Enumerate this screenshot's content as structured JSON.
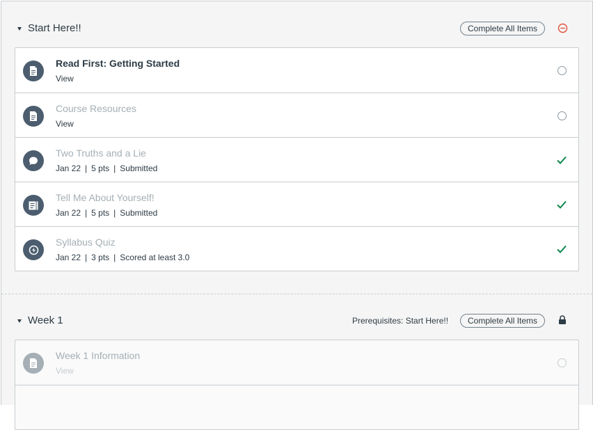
{
  "colors": {
    "complete_check": "#0b874b",
    "remove_icon": "#e0533d",
    "icon_bg": "#4b5d6e"
  },
  "modules": [
    {
      "title": "Start Here!!",
      "complete_all_label": "Complete All Items",
      "header_icon": "minus-circle-icon",
      "items": [
        {
          "title": "Read First: Getting Started",
          "meta": [
            "View"
          ],
          "icon": "page-icon",
          "status": "incomplete"
        },
        {
          "title": "Course Resources",
          "meta": [
            "View"
          ],
          "icon": "page-icon",
          "status": "incomplete"
        },
        {
          "title": "Two Truths and a Lie",
          "meta": [
            "Jan 22",
            "5 pts",
            "Submitted"
          ],
          "icon": "discussion-icon",
          "status": "complete"
        },
        {
          "title": "Tell Me About Yourself!",
          "meta": [
            "Jan 22",
            "5 pts",
            "Submitted"
          ],
          "icon": "assignment-icon",
          "status": "complete"
        },
        {
          "title": "Syllabus Quiz",
          "meta": [
            "Jan 22",
            "3 pts",
            "Scored at least 3.0"
          ],
          "icon": "quiz-icon",
          "status": "complete"
        }
      ]
    },
    {
      "title": "Week 1",
      "prerequisites": "Prerequisites: Start Here!!",
      "complete_all_label": "Complete All Items",
      "header_icon": "lock-icon",
      "items": [
        {
          "title": "Week 1 Information",
          "meta": [
            "View"
          ],
          "icon": "page-icon",
          "status": "locked"
        }
      ]
    }
  ]
}
